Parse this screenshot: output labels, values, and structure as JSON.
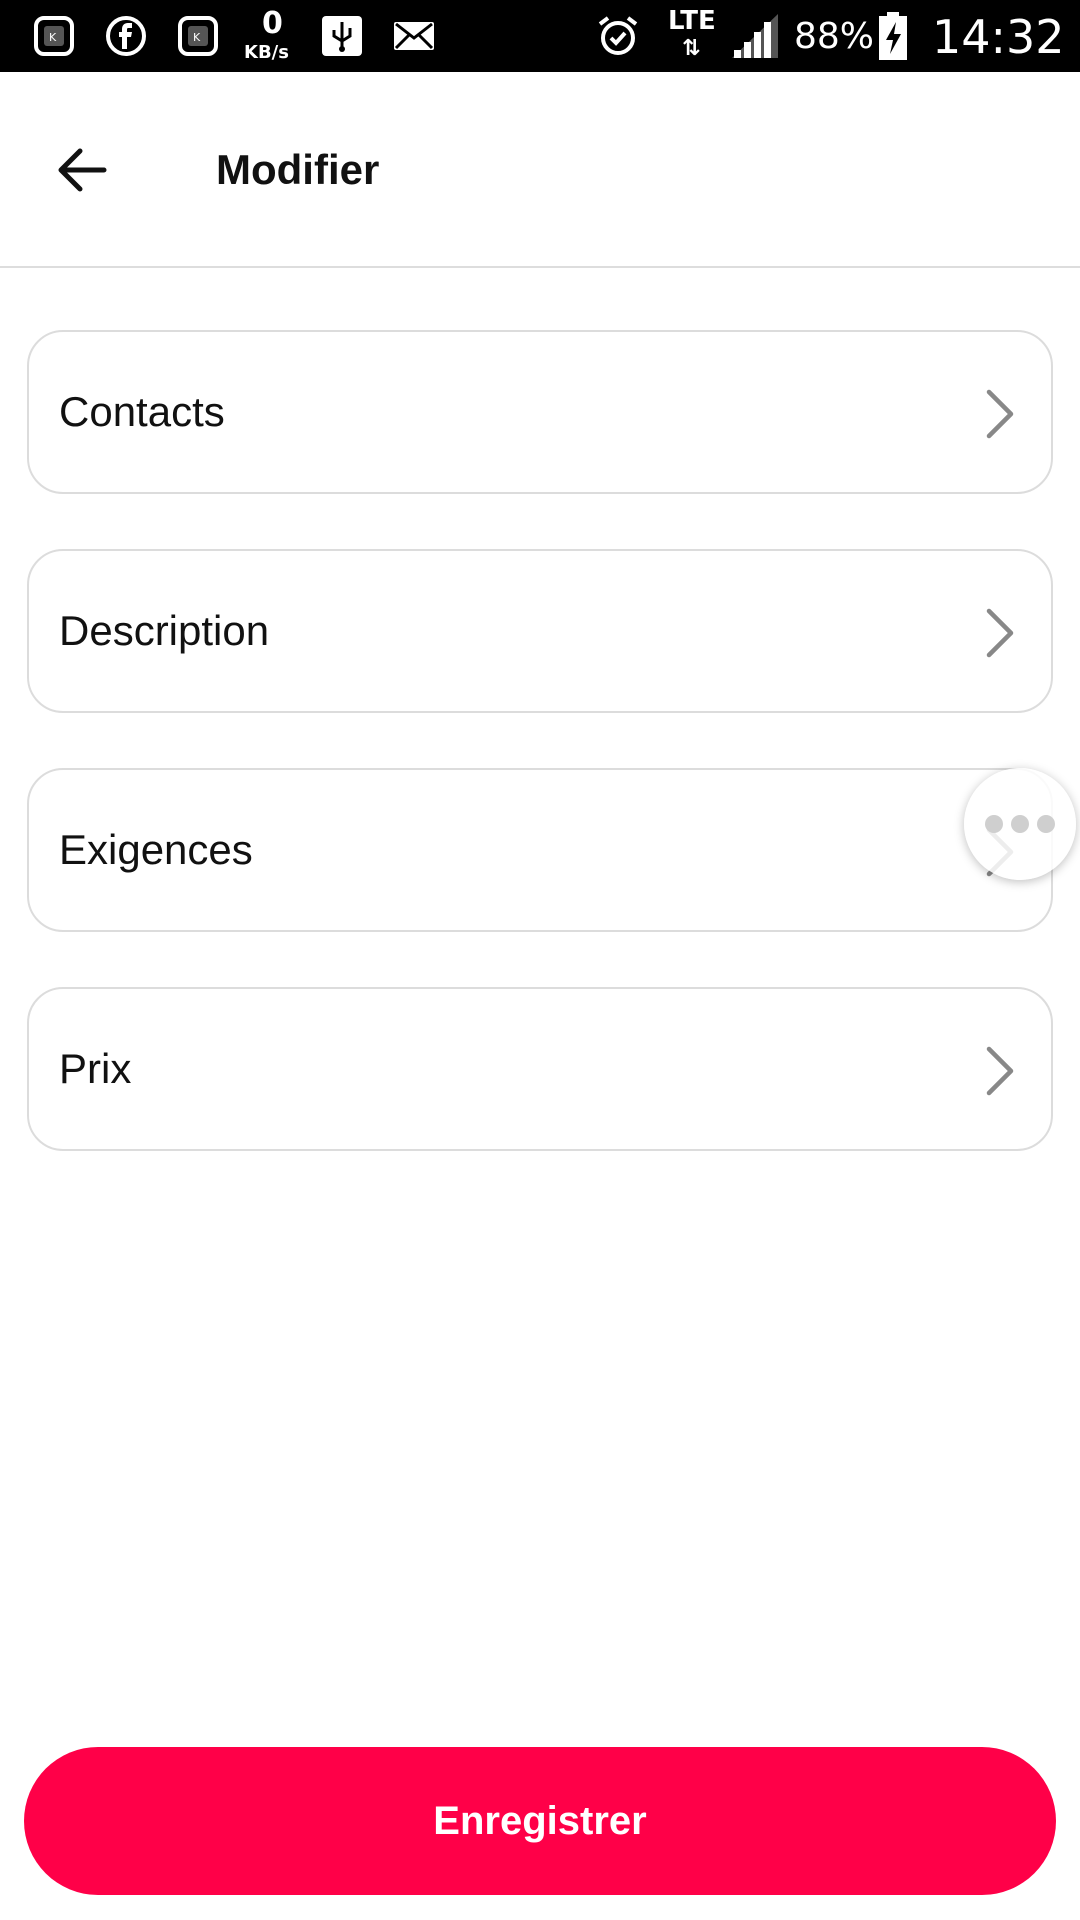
{
  "status_bar": {
    "network_speed_value": "0",
    "network_speed_unit": "KB/s",
    "network_type": "LTE",
    "battery_percent": "88%",
    "time": "14:32",
    "icons": [
      "app-k-icon",
      "facebook-icon",
      "app-k-icon",
      "usb-icon",
      "mail-icon",
      "alarm-icon",
      "signal-icon",
      "battery-charging-icon"
    ]
  },
  "header": {
    "back_icon": "arrow-left-icon",
    "title": "Modifier"
  },
  "menu": {
    "items": [
      {
        "label": "Contacts",
        "icon": "chevron-right-icon"
      },
      {
        "label": "Description",
        "icon": "chevron-right-icon"
      },
      {
        "label": "Exigences",
        "icon": "chevron-right-icon"
      },
      {
        "label": "Prix",
        "icon": "chevron-right-icon"
      }
    ]
  },
  "floating_button": {
    "icon": "more-dots-icon"
  },
  "footer": {
    "save_label": "Enregistrer"
  },
  "colors": {
    "accent": "#ff0048",
    "status_bar_bg": "#000000",
    "card_border": "#dcdcdc"
  }
}
